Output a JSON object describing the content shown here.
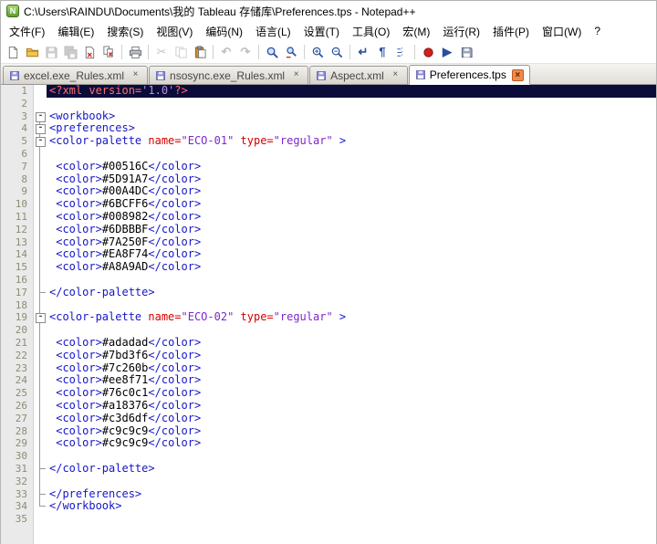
{
  "window": {
    "title": "C:\\Users\\RAINDU\\Documents\\我的 Tableau 存储库\\Preferences.tps - Notepad++",
    "app_icon": "notepad-plus-plus-icon"
  },
  "menu": {
    "items": [
      "文件(F)",
      "编辑(E)",
      "搜索(S)",
      "视图(V)",
      "编码(N)",
      "语言(L)",
      "设置(T)",
      "工具(O)",
      "宏(M)",
      "运行(R)",
      "插件(P)",
      "窗口(W)",
      "?"
    ]
  },
  "toolbar": {
    "icons": [
      {
        "name": "new-file"
      },
      {
        "name": "open-folder"
      },
      {
        "name": "save",
        "disabled": true
      },
      {
        "name": "save-all",
        "disabled": true
      },
      {
        "name": "close-file"
      },
      {
        "name": "close-all-files"
      },
      {
        "name": "print",
        "sep": true
      },
      {
        "name": "cut",
        "disabled": true,
        "sep": true
      },
      {
        "name": "copy",
        "disabled": true
      },
      {
        "name": "paste"
      },
      {
        "name": "undo",
        "disabled": true,
        "sep": true
      },
      {
        "name": "redo",
        "disabled": true
      },
      {
        "name": "find",
        "sep": true
      },
      {
        "name": "replace"
      },
      {
        "name": "zoom-in",
        "sep": true
      },
      {
        "name": "zoom-out"
      },
      {
        "name": "word-wrap",
        "sep": true
      },
      {
        "name": "show-all-chars"
      },
      {
        "name": "indent-guide"
      },
      {
        "name": "record-macro",
        "sep": true
      },
      {
        "name": "play-macro"
      },
      {
        "name": "save-macro"
      }
    ]
  },
  "tabbar": {
    "close_glyph": "×",
    "tab_icon": "saved-file-icon",
    "tabs": [
      {
        "label": "excel.exe_Rules.xml",
        "active": false
      },
      {
        "label": "nsosync.exe_Rules.xml",
        "active": false
      },
      {
        "label": "Aspect.xml",
        "active": false
      },
      {
        "label": "Preferences.tps",
        "active": true
      }
    ]
  },
  "editor": {
    "syntax_colors": {
      "tag": "#1616c8",
      "attr": "#d40000",
      "val": "#7d26cd",
      "txt": "#000000",
      "decl": "#ff6d6d",
      "declval": "#b78fe6",
      "selection_bg": "#0c0c3a"
    },
    "palette_names": [
      "ECO-01",
      "ECO-02"
    ],
    "palette_1_colors": [
      "#00516C",
      "#5D91A7",
      "#00A4DC",
      "#6BCFF6",
      "#008982",
      "#6DBBBF",
      "#7A250F",
      "#EA8F74",
      "#A8A9AD"
    ],
    "palette_2_colors": [
      "#adadad",
      "#7bd3f6",
      "#7c260b",
      "#ee8f71",
      "#76c0c1",
      "#a18376",
      "#c3d6df",
      "#c9c9c9",
      "#c9c9c9"
    ],
    "lines": [
      {
        "num": 1,
        "fold": "none",
        "selected": true,
        "segs": [
          [
            "<?xml version=",
            "decl"
          ],
          [
            "'1.0'",
            "declval"
          ],
          [
            "?>",
            "decl"
          ]
        ]
      },
      {
        "num": 2,
        "fold": "none",
        "segs": []
      },
      {
        "num": 3,
        "fold": "box",
        "segs": [
          [
            "<workbook>",
            "tag"
          ]
        ]
      },
      {
        "num": 4,
        "fold": "boxline",
        "segs": [
          [
            "<preferences>",
            "tag"
          ]
        ]
      },
      {
        "num": 5,
        "fold": "boxline",
        "segs": [
          [
            "<color-palette ",
            "tag"
          ],
          [
            "name=",
            "attr"
          ],
          [
            "\"ECO-01\"",
            "val"
          ],
          [
            " ",
            "txt"
          ],
          [
            "type=",
            "attr"
          ],
          [
            "\"regular\"",
            "val"
          ],
          [
            " >",
            "tag"
          ]
        ]
      },
      {
        "num": 6,
        "fold": "line",
        "segs": []
      },
      {
        "num": 7,
        "fold": "line",
        "segs": [
          [
            " ",
            "txt"
          ],
          [
            "<color>",
            "tag"
          ],
          [
            "#00516C",
            "txt"
          ],
          [
            "</color>",
            "tag"
          ]
        ]
      },
      {
        "num": 8,
        "fold": "line",
        "segs": [
          [
            " ",
            "txt"
          ],
          [
            "<color>",
            "tag"
          ],
          [
            "#5D91A7",
            "txt"
          ],
          [
            "</color>",
            "tag"
          ]
        ]
      },
      {
        "num": 9,
        "fold": "line",
        "segs": [
          [
            " ",
            "txt"
          ],
          [
            "<color>",
            "tag"
          ],
          [
            "#00A4DC",
            "txt"
          ],
          [
            "</color>",
            "tag"
          ]
        ]
      },
      {
        "num": 10,
        "fold": "line",
        "segs": [
          [
            " ",
            "txt"
          ],
          [
            "<color>",
            "tag"
          ],
          [
            "#6BCFF6",
            "txt"
          ],
          [
            "</color>",
            "tag"
          ]
        ]
      },
      {
        "num": 11,
        "fold": "line",
        "segs": [
          [
            " ",
            "txt"
          ],
          [
            "<color>",
            "tag"
          ],
          [
            "#008982",
            "txt"
          ],
          [
            "</color>",
            "tag"
          ]
        ]
      },
      {
        "num": 12,
        "fold": "line",
        "segs": [
          [
            " ",
            "txt"
          ],
          [
            "<color>",
            "tag"
          ],
          [
            "#6DBBBF",
            "txt"
          ],
          [
            "</color>",
            "tag"
          ]
        ]
      },
      {
        "num": 13,
        "fold": "line",
        "segs": [
          [
            " ",
            "txt"
          ],
          [
            "<color>",
            "tag"
          ],
          [
            "#7A250F",
            "txt"
          ],
          [
            "</color>",
            "tag"
          ]
        ]
      },
      {
        "num": 14,
        "fold": "line",
        "segs": [
          [
            " ",
            "txt"
          ],
          [
            "<color>",
            "tag"
          ],
          [
            "#EA8F74",
            "txt"
          ],
          [
            "</color>",
            "tag"
          ]
        ]
      },
      {
        "num": 15,
        "fold": "line",
        "segs": [
          [
            " ",
            "txt"
          ],
          [
            "<color>",
            "tag"
          ],
          [
            "#A8A9AD",
            "txt"
          ],
          [
            "</color>",
            "tag"
          ]
        ]
      },
      {
        "num": 16,
        "fold": "line",
        "segs": []
      },
      {
        "num": 17,
        "fold": "tcorner",
        "segs": [
          [
            "</color-palette>",
            "tag"
          ]
        ]
      },
      {
        "num": 18,
        "fold": "line",
        "segs": []
      },
      {
        "num": 19,
        "fold": "boxline",
        "segs": [
          [
            "<color-palette ",
            "tag"
          ],
          [
            "name=",
            "attr"
          ],
          [
            "\"ECO-02\"",
            "val"
          ],
          [
            " ",
            "txt"
          ],
          [
            "type=",
            "attr"
          ],
          [
            "\"regular\"",
            "val"
          ],
          [
            " >",
            "tag"
          ]
        ]
      },
      {
        "num": 20,
        "fold": "line",
        "segs": []
      },
      {
        "num": 21,
        "fold": "line",
        "segs": [
          [
            " ",
            "txt"
          ],
          [
            "<color>",
            "tag"
          ],
          [
            "#adadad",
            "txt"
          ],
          [
            "</color>",
            "tag"
          ]
        ]
      },
      {
        "num": 22,
        "fold": "line",
        "segs": [
          [
            " ",
            "txt"
          ],
          [
            "<color>",
            "tag"
          ],
          [
            "#7bd3f6",
            "txt"
          ],
          [
            "</color>",
            "tag"
          ]
        ]
      },
      {
        "num": 23,
        "fold": "line",
        "segs": [
          [
            " ",
            "txt"
          ],
          [
            "<color>",
            "tag"
          ],
          [
            "#7c260b",
            "txt"
          ],
          [
            "</color>",
            "tag"
          ]
        ]
      },
      {
        "num": 24,
        "fold": "line",
        "segs": [
          [
            " ",
            "txt"
          ],
          [
            "<color>",
            "tag"
          ],
          [
            "#ee8f71",
            "txt"
          ],
          [
            "</color>",
            "tag"
          ]
        ]
      },
      {
        "num": 25,
        "fold": "line",
        "segs": [
          [
            " ",
            "txt"
          ],
          [
            "<color>",
            "tag"
          ],
          [
            "#76c0c1",
            "txt"
          ],
          [
            "</color>",
            "tag"
          ]
        ]
      },
      {
        "num": 26,
        "fold": "line",
        "segs": [
          [
            " ",
            "txt"
          ],
          [
            "<color>",
            "tag"
          ],
          [
            "#a18376",
            "txt"
          ],
          [
            "</color>",
            "tag"
          ]
        ]
      },
      {
        "num": 27,
        "fold": "line",
        "segs": [
          [
            " ",
            "txt"
          ],
          [
            "<color>",
            "tag"
          ],
          [
            "#c3d6df",
            "txt"
          ],
          [
            "</color>",
            "tag"
          ]
        ]
      },
      {
        "num": 28,
        "fold": "line",
        "segs": [
          [
            " ",
            "txt"
          ],
          [
            "<color>",
            "tag"
          ],
          [
            "#c9c9c9",
            "txt"
          ],
          [
            "</color>",
            "tag"
          ]
        ]
      },
      {
        "num": 29,
        "fold": "line",
        "segs": [
          [
            " ",
            "txt"
          ],
          [
            "<color>",
            "tag"
          ],
          [
            "#c9c9c9",
            "txt"
          ],
          [
            "</color>",
            "tag"
          ]
        ]
      },
      {
        "num": 30,
        "fold": "line",
        "segs": []
      },
      {
        "num": 31,
        "fold": "tcorner",
        "segs": [
          [
            "</color-palette>",
            "tag"
          ]
        ]
      },
      {
        "num": 32,
        "fold": "line",
        "segs": []
      },
      {
        "num": 33,
        "fold": "tcorner",
        "segs": [
          [
            "</preferences>",
            "tag"
          ]
        ]
      },
      {
        "num": 34,
        "fold": "lcorner",
        "segs": [
          [
            "</workbook>",
            "tag"
          ]
        ]
      },
      {
        "num": 35,
        "fold": "none",
        "segs": []
      }
    ]
  }
}
